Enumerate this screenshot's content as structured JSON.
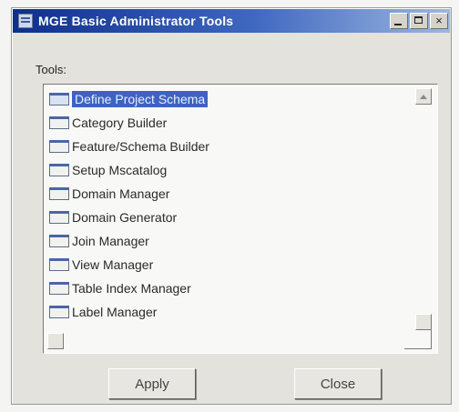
{
  "window": {
    "title": "MGE Basic Administrator Tools",
    "controls": {
      "minimize_icon": "minimize-icon",
      "maximize_icon": "maximize-icon",
      "close_icon": "close-icon",
      "close_glyph": "×"
    }
  },
  "tools": {
    "label": "Tools:",
    "selected_index": 0,
    "items": [
      {
        "label": "Define Project Schema",
        "icon": "tool-window-icon"
      },
      {
        "label": "Category Builder",
        "icon": "tool-window-icon"
      },
      {
        "label": "Feature/Schema Builder",
        "icon": "tool-window-icon"
      },
      {
        "label": "Setup Mscatalog",
        "icon": "tool-window-icon"
      },
      {
        "label": "Domain Manager",
        "icon": "tool-window-icon"
      },
      {
        "label": "Domain Generator",
        "icon": "tool-window-icon"
      },
      {
        "label": "Join Manager",
        "icon": "tool-window-icon"
      },
      {
        "label": "View Manager",
        "icon": "tool-window-icon"
      },
      {
        "label": "Table Index Manager",
        "icon": "tool-window-icon"
      },
      {
        "label": "Label Manager",
        "icon": "tool-window-icon"
      }
    ]
  },
  "buttons": {
    "apply": "Apply",
    "close": "Close"
  },
  "colors": {
    "titlebar_start": "#0e2f8c",
    "titlebar_end": "#9db6df",
    "selection": "#3d63c2",
    "dialog_bg": "#e4e2dc"
  }
}
